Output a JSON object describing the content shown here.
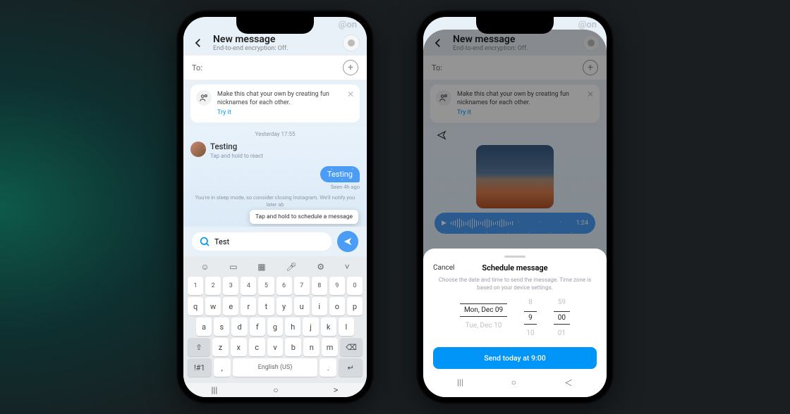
{
  "watermark": "@on",
  "phone1": {
    "header": {
      "title": "New message",
      "subtitle": "End-to-end encryption: Off."
    },
    "to": {
      "label": "To:"
    },
    "banner": {
      "text": "Make this chat your own by creating fun nicknames for each other.",
      "try": "Try it"
    },
    "timestamp": "Yesterday 17:55",
    "msg_in": {
      "text": "Testing",
      "hint": "Tap and hold to react"
    },
    "msg_out": {
      "text": "Testing"
    },
    "seen": "Seen 4h ago",
    "sleep": "You're in sleep mode, so consider closing Instagram. We'll notify you later ab",
    "tooltip": "Tap and hold to schedule a message",
    "input": {
      "value": "Test"
    },
    "keyboard": {
      "nums": [
        "1",
        "2",
        "3",
        "4",
        "5",
        "6",
        "7",
        "8",
        "9",
        "0"
      ],
      "row1": [
        "q",
        "w",
        "e",
        "r",
        "t",
        "y",
        "u",
        "i",
        "o",
        "p"
      ],
      "row2": [
        "a",
        "s",
        "d",
        "f",
        "g",
        "h",
        "j",
        "k",
        "l"
      ],
      "row3": [
        "z",
        "x",
        "c",
        "v",
        "b",
        "n",
        "m"
      ],
      "lang": "English (US)",
      "sym": "!#1"
    }
  },
  "phone2": {
    "header": {
      "title": "New message",
      "subtitle": "End-to-end encryption: Off."
    },
    "banner": {
      "text": "Make this chat your own by creating fun nicknames for each other.",
      "try": "Try it"
    },
    "voice": {
      "time": "1:24"
    },
    "sheet": {
      "cancel": "Cancel",
      "title": "Schedule message",
      "desc": "Choose the date and time to send the message. Time zone is based on your device settings.",
      "picker": {
        "prev": {
          "date": "",
          "hour": "8",
          "min": "59"
        },
        "sel": {
          "date": "Mon, Dec 09",
          "hour": "9",
          "min": "00"
        },
        "next": {
          "date": "Tue, Dec 10",
          "hour": "10",
          "min": "01"
        }
      },
      "button": "Send today at 9:00"
    }
  }
}
